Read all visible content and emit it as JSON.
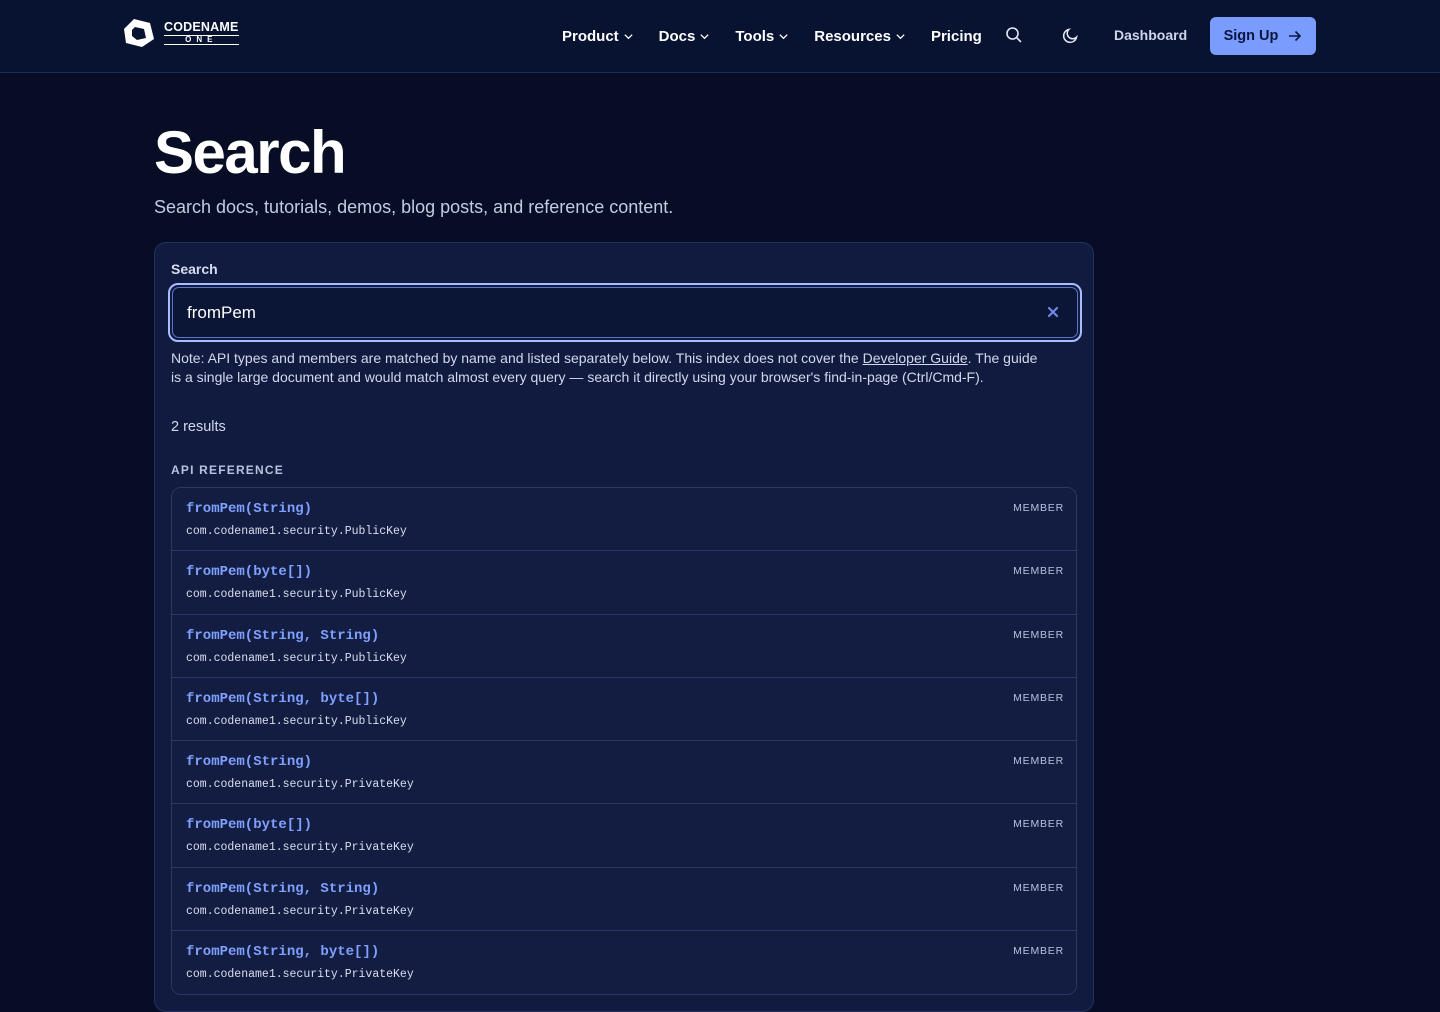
{
  "header": {
    "logo_word": "CODENAME",
    "logo_sub": "ONE",
    "nav": [
      {
        "label": "Product",
        "dropdown": true
      },
      {
        "label": "Docs",
        "dropdown": true
      },
      {
        "label": "Tools",
        "dropdown": true
      },
      {
        "label": "Resources",
        "dropdown": true
      },
      {
        "label": "Pricing",
        "dropdown": false
      }
    ],
    "search_icon": "search-icon",
    "theme_icon": "moon-icon",
    "dashboard_label": "Dashboard",
    "signup_label": "Sign Up",
    "signup_icon": "arrow-right-icon",
    "accent_color": "#7b9cff"
  },
  "page": {
    "title": "Search",
    "subtitle": "Search docs, tutorials, demos, blog posts, and reference content."
  },
  "search": {
    "label": "Search",
    "value": "fromPem",
    "clear_icon": "close-icon",
    "note_prefix": "Note: API types and members are matched by name and listed separately below. This index does not cover the ",
    "note_link": "Developer Guide",
    "note_suffix": ". The guide is a single large document and would match almost every query — search it directly using your browser's find-in-page (Ctrl/Cmd-F).",
    "result_count": "2 results",
    "section_heading": "API REFERENCE"
  },
  "results": [
    {
      "title": "fromPem(String)",
      "package": "com.codename1.security.PublicKey",
      "badge": "MEMBER"
    },
    {
      "title": "fromPem(byte[])",
      "package": "com.codename1.security.PublicKey",
      "badge": "MEMBER"
    },
    {
      "title": "fromPem(String, String)",
      "package": "com.codename1.security.PublicKey",
      "badge": "MEMBER"
    },
    {
      "title": "fromPem(String, byte[])",
      "package": "com.codename1.security.PublicKey",
      "badge": "MEMBER"
    },
    {
      "title": "fromPem(String)",
      "package": "com.codename1.security.PrivateKey",
      "badge": "MEMBER"
    },
    {
      "title": "fromPem(byte[])",
      "package": "com.codename1.security.PrivateKey",
      "badge": "MEMBER"
    },
    {
      "title": "fromPem(String, String)",
      "package": "com.codename1.security.PrivateKey",
      "badge": "MEMBER"
    },
    {
      "title": "fromPem(String, byte[])",
      "package": "com.codename1.security.PrivateKey",
      "badge": "MEMBER"
    }
  ]
}
